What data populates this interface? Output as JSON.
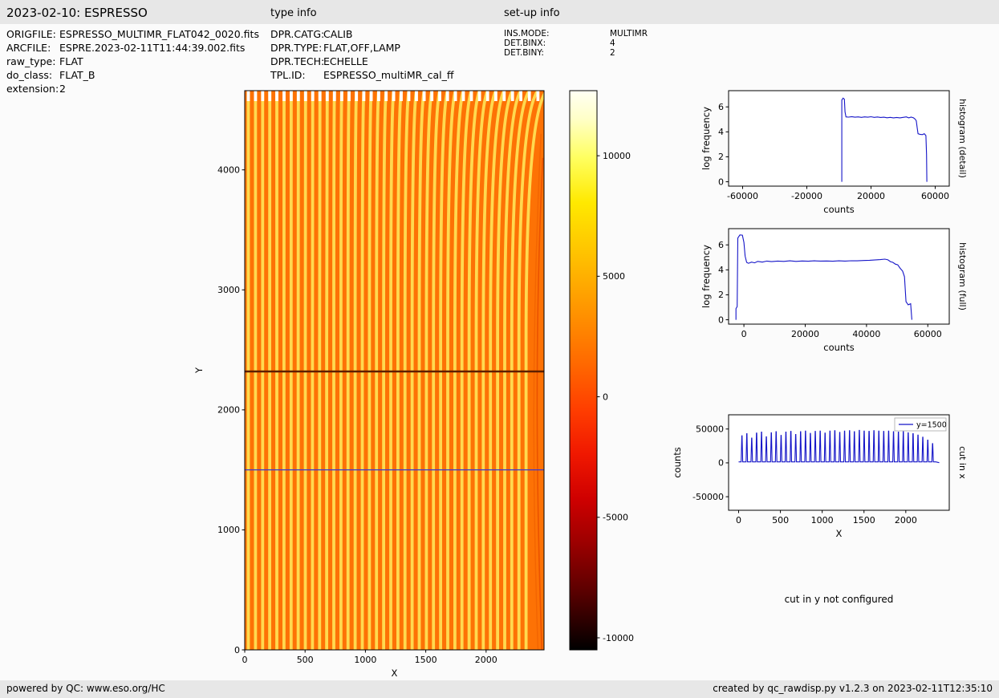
{
  "header": {
    "title": "2023-02-10: ESPRESSO",
    "type_info_label": "type info",
    "setup_info_label": "set-up info"
  },
  "metadata": {
    "file": [
      {
        "key": "ORIGFILE:",
        "value": "ESPRESSO_MULTIMR_FLAT042_0020.fits"
      },
      {
        "key": "ARCFILE:",
        "value": "ESPRE.2023-02-11T11:44:39.002.fits"
      },
      {
        "key": "raw_type:",
        "value": "FLAT"
      },
      {
        "key": "do_class:",
        "value": "FLAT_B"
      },
      {
        "key": "extension:",
        "value": "2"
      }
    ],
    "type_info": [
      {
        "key": "DPR.CATG:",
        "value": "CALIB"
      },
      {
        "key": "DPR.TYPE:",
        "value": "FLAT,OFF,LAMP"
      },
      {
        "key": "DPR.TECH:",
        "value": "ECHELLE"
      },
      {
        "key": "TPL.ID:",
        "value": "ESPRESSO_multiMR_cal_ff"
      }
    ],
    "setup_info": [
      {
        "key": "INS.MODE:",
        "value": "MULTIMR"
      },
      {
        "key": "DET.BINX:",
        "value": "4"
      },
      {
        "key": "DET.BINY:",
        "value": "2"
      }
    ]
  },
  "notes": {
    "cut_in_y": "cut in y not configured"
  },
  "footer": {
    "left": "powered by QC: www.eso.org/HC",
    "right": "created by qc_rawdisp.py v1.2.3 on 2023-02-11T12:35:10"
  },
  "chart_data": [
    {
      "id": "raster",
      "type": "heatmap",
      "xlabel": "X",
      "ylabel": "Y",
      "xlim": [
        0,
        2480
      ],
      "ylim": [
        0,
        4660
      ],
      "xticks": [
        0,
        500,
        1000,
        1500,
        2000
      ],
      "yticks": [
        0,
        1000,
        2000,
        3000,
        4000
      ],
      "n_orders": 40,
      "order_x_first": 30,
      "order_x_spacing": 59,
      "order_curve_max_shift": 170,
      "background_color": "#fd7205",
      "stripe_color": "#ffd94f",
      "stripe_top_color": "#ffffff",
      "defect_row_y": 2320,
      "defect_row_color": "#5f1f00",
      "cut_line_y": 1500,
      "cut_line_color": "#3b3bd0",
      "colorbar": {
        "ticks": [
          10000,
          5000,
          0,
          -5000,
          -10000
        ],
        "vmax": 12700,
        "vmin": -10500,
        "gradient": [
          [
            0,
            "#fffff4"
          ],
          [
            0.05,
            "#ffffc8"
          ],
          [
            0.12,
            "#ffff60"
          ],
          [
            0.2,
            "#ffe900"
          ],
          [
            0.29,
            "#ffc300"
          ],
          [
            0.39,
            "#ff9600"
          ],
          [
            0.49,
            "#ff6800"
          ],
          [
            0.57,
            "#ff3e00"
          ],
          [
            0.65,
            "#f01800"
          ],
          [
            0.73,
            "#cf0000"
          ],
          [
            0.81,
            "#9b0000"
          ],
          [
            0.89,
            "#5f0000"
          ],
          [
            1,
            "#000000"
          ]
        ]
      }
    },
    {
      "id": "hist_detail",
      "type": "line",
      "xlabel": "counts",
      "ylabel": "log frequency",
      "right_label": "histogram (detail)",
      "xlim": [
        -68750,
        68750
      ],
      "ylim": [
        -0.35,
        7.3
      ],
      "xticks": [
        -60000,
        -20000,
        20000,
        60000
      ],
      "yticks": [
        0,
        2,
        4,
        6
      ],
      "line_color": "#1515c8",
      "points": [
        [
          1800,
          0
        ],
        [
          1800,
          6.55
        ],
        [
          2600,
          6.7
        ],
        [
          3400,
          6.62
        ],
        [
          3800,
          5.6
        ],
        [
          4400,
          5.2
        ],
        [
          6000,
          5.18
        ],
        [
          8000,
          5.22
        ],
        [
          10000,
          5.17
        ],
        [
          12000,
          5.2
        ],
        [
          14000,
          5.16
        ],
        [
          16000,
          5.2
        ],
        [
          18000,
          5.17
        ],
        [
          20000,
          5.21
        ],
        [
          22000,
          5.16
        ],
        [
          24000,
          5.19
        ],
        [
          26000,
          5.15
        ],
        [
          28000,
          5.17
        ],
        [
          30000,
          5.13
        ],
        [
          32000,
          5.16
        ],
        [
          34000,
          5.12
        ],
        [
          36000,
          5.15
        ],
        [
          38000,
          5.12
        ],
        [
          40000,
          5.16
        ],
        [
          42000,
          5.2
        ],
        [
          43500,
          5.12
        ],
        [
          45000,
          5.18
        ],
        [
          46500,
          5.12
        ],
        [
          47500,
          5.02
        ],
        [
          48200,
          4.88
        ],
        [
          48800,
          4.3
        ],
        [
          49300,
          3.85
        ],
        [
          50500,
          3.8
        ],
        [
          52000,
          3.78
        ],
        [
          53200,
          3.85
        ],
        [
          54200,
          3.7
        ],
        [
          54600,
          2.2
        ],
        [
          54800,
          0
        ]
      ]
    },
    {
      "id": "hist_full",
      "type": "line",
      "xlabel": "counts",
      "ylabel": "log frequency",
      "right_label": "histogram (full)",
      "xlim": [
        -5000,
        67000
      ],
      "ylim": [
        -0.35,
        7.3
      ],
      "xticks": [
        0,
        20000,
        40000,
        60000
      ],
      "yticks": [
        0,
        2,
        4,
        6
      ],
      "line_color": "#1515c8",
      "points": [
        [
          -2600,
          0
        ],
        [
          -2600,
          0.9
        ],
        [
          -2200,
          1.05
        ],
        [
          -2000,
          6.55
        ],
        [
          -1300,
          6.8
        ],
        [
          -500,
          6.78
        ],
        [
          0,
          6.2
        ],
        [
          400,
          5.1
        ],
        [
          900,
          4.6
        ],
        [
          1500,
          4.52
        ],
        [
          2500,
          4.62
        ],
        [
          3500,
          4.56
        ],
        [
          4500,
          4.68
        ],
        [
          6000,
          4.62
        ],
        [
          7500,
          4.7
        ],
        [
          9000,
          4.66
        ],
        [
          11000,
          4.7
        ],
        [
          13000,
          4.68
        ],
        [
          15000,
          4.72
        ],
        [
          17000,
          4.68
        ],
        [
          19000,
          4.71
        ],
        [
          21000,
          4.69
        ],
        [
          23000,
          4.72
        ],
        [
          25000,
          4.7
        ],
        [
          27000,
          4.71
        ],
        [
          29000,
          4.69
        ],
        [
          31000,
          4.72
        ],
        [
          33000,
          4.7
        ],
        [
          35000,
          4.73
        ],
        [
          37000,
          4.72
        ],
        [
          39000,
          4.75
        ],
        [
          41000,
          4.77
        ],
        [
          43000,
          4.8
        ],
        [
          44500,
          4.82
        ],
        [
          46000,
          4.86
        ],
        [
          47000,
          4.8
        ],
        [
          47800,
          4.66
        ],
        [
          48600,
          4.6
        ],
        [
          49400,
          4.46
        ],
        [
          50200,
          4.4
        ],
        [
          51000,
          4.12
        ],
        [
          51800,
          3.9
        ],
        [
          52400,
          3.45
        ],
        [
          52900,
          1.45
        ],
        [
          53600,
          1.2
        ],
        [
          54400,
          1.28
        ],
        [
          54800,
          0
        ]
      ]
    },
    {
      "id": "cut_x",
      "type": "line",
      "xlabel": "X",
      "ylabel": "counts",
      "right_label": "cut in x",
      "legend": "y=1500",
      "xlim": [
        -120,
        2520
      ],
      "ylim": [
        -70000,
        71000
      ],
      "xticks": [
        0,
        500,
        1000,
        1500,
        2000
      ],
      "yticks": [
        -50000,
        0,
        50000
      ],
      "line_color": "#1515c8",
      "baseline": 1500,
      "peak_half_width": 9,
      "x_end": 2400,
      "peaks": [
        [
          40,
          40000
        ],
        [
          98,
          43000
        ],
        [
          157,
          36500
        ],
        [
          215,
          44000
        ],
        [
          274,
          45500
        ],
        [
          332,
          38500
        ],
        [
          391,
          44500
        ],
        [
          449,
          46000
        ],
        [
          508,
          40500
        ],
        [
          566,
          45500
        ],
        [
          625,
          46500
        ],
        [
          683,
          42000
        ],
        [
          742,
          46000
        ],
        [
          800,
          47000
        ],
        [
          859,
          43500
        ],
        [
          917,
          46500
        ],
        [
          976,
          47000
        ],
        [
          1034,
          44000
        ],
        [
          1093,
          47000
        ],
        [
          1151,
          47500
        ],
        [
          1210,
          45000
        ],
        [
          1268,
          47000
        ],
        [
          1327,
          47500
        ],
        [
          1385,
          46000
        ],
        [
          1444,
          48000
        ],
        [
          1502,
          47000
        ],
        [
          1561,
          46500
        ],
        [
          1619,
          47500
        ],
        [
          1678,
          47000
        ],
        [
          1736,
          46500
        ],
        [
          1795,
          47000
        ],
        [
          1853,
          46000
        ],
        [
          1912,
          45500
        ],
        [
          1970,
          46000
        ],
        [
          2029,
          44500
        ],
        [
          2087,
          43000
        ],
        [
          2146,
          41000
        ],
        [
          2204,
          38000
        ],
        [
          2263,
          33500
        ],
        [
          2321,
          28500
        ]
      ]
    }
  ]
}
